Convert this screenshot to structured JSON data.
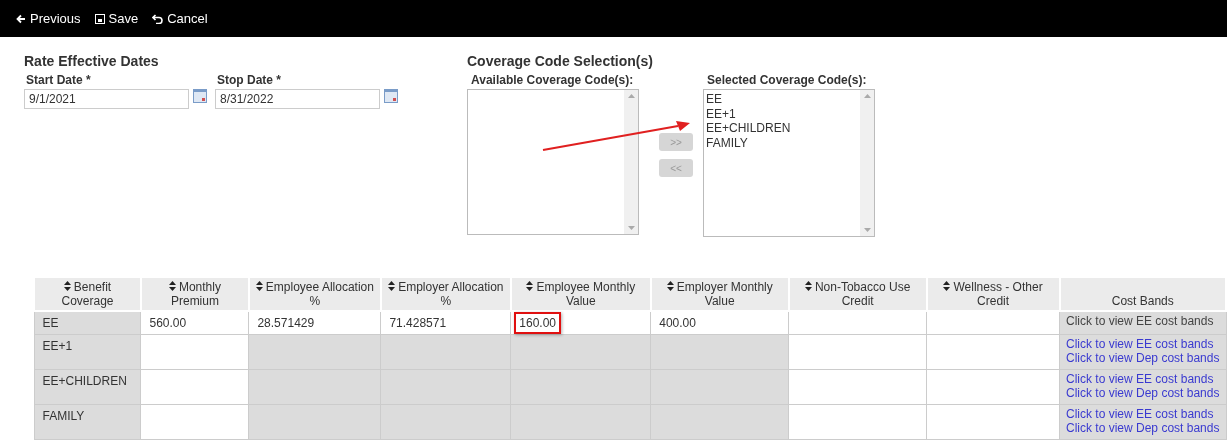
{
  "toolbar": [
    {
      "kind": "previous",
      "label": "Previous"
    },
    {
      "kind": "save",
      "label": "Save"
    },
    {
      "kind": "cancel",
      "label": "Cancel"
    }
  ],
  "rate_effective_dates": {
    "title": "Rate Effective Dates",
    "fields": [
      {
        "label": "Start Date *",
        "value": "9/1/2021"
      },
      {
        "label": "Stop Date *",
        "value": "8/31/2022"
      }
    ]
  },
  "coverage_code_selection": {
    "title": "Coverage Code Selection(s)",
    "available": {
      "label": "Available Coverage Code(s):"
    },
    "move_buttons": [
      {
        "label": ">>",
        "disabled": true
      },
      {
        "label": "<<",
        "disabled": true
      }
    ],
    "selected": {
      "label": "Selected Coverage Code(s):",
      "items": [
        "EE",
        "EE+1",
        "EE+CHILDREN",
        "FAMILY"
      ]
    }
  },
  "table": {
    "columns": [
      {
        "label": "Benefit Coverage",
        "sortable": true
      },
      {
        "label": "Monthly Premium",
        "sortable": true
      },
      {
        "label": "Employee Allocation %",
        "sortable": true
      },
      {
        "label": "Employer Allocation %",
        "sortable": true
      },
      {
        "label": "Employee Monthly Value",
        "sortable": true
      },
      {
        "label": "Employer Monthly Value",
        "sortable": true
      },
      {
        "label": "Non-Tobacco Use Credit",
        "sortable": true
      },
      {
        "label": "Wellness - Other Credit",
        "sortable": true
      },
      {
        "label": "Cost Bands",
        "sortable": false
      }
    ],
    "rows": [
      {
        "cells": [
          {
            "value": "EE",
            "editable": false
          },
          {
            "value": "560.00",
            "editable": true
          },
          {
            "value": "28.571429",
            "editable": true
          },
          {
            "value": "71.428571",
            "editable": true
          },
          {
            "value": "160.00",
            "editable": true,
            "highlighted": true
          },
          {
            "value": "400.00",
            "editable": true
          },
          {
            "editable": true
          },
          {
            "editable": true
          }
        ],
        "links": [
          {
            "label": "Click to view EE cost bands",
            "disabled": true
          }
        ]
      },
      {
        "cells": [
          {
            "value": "EE+1",
            "editable": false
          },
          {
            "editable": true
          },
          {
            "editable": false
          },
          {
            "editable": false
          },
          {
            "editable": false
          },
          {
            "editable": false
          },
          {
            "editable": true
          },
          {
            "editable": true
          }
        ],
        "links": [
          {
            "label": "Click to view EE cost bands",
            "disabled": false
          },
          {
            "label": "Click to view Dep cost bands",
            "disabled": false
          }
        ]
      },
      {
        "cells": [
          {
            "value": "EE+CHILDREN",
            "editable": false
          },
          {
            "editable": true
          },
          {
            "editable": false
          },
          {
            "editable": false
          },
          {
            "editable": false
          },
          {
            "editable": false
          },
          {
            "editable": true
          },
          {
            "editable": true
          }
        ],
        "links": [
          {
            "label": "Click to view EE cost bands",
            "disabled": false
          },
          {
            "label": "Click to view Dep cost bands",
            "disabled": false
          }
        ]
      },
      {
        "cells": [
          {
            "value": "FAMILY",
            "editable": false
          },
          {
            "editable": true
          },
          {
            "editable": false
          },
          {
            "editable": false
          },
          {
            "editable": false
          },
          {
            "editable": false
          },
          {
            "editable": true
          },
          {
            "editable": true
          }
        ],
        "links": [
          {
            "label": "Click to view EE cost bands",
            "disabled": false
          },
          {
            "label": "Click to view Dep cost bands",
            "disabled": false
          }
        ]
      }
    ]
  }
}
